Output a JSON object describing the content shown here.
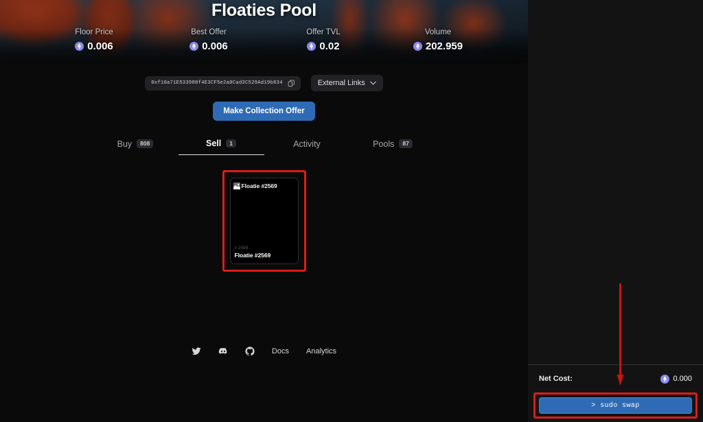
{
  "banner": {
    "title": "Floaties Pool",
    "background_alt": "blurred collection banner art",
    "stats": [
      {
        "label": "Floor Price",
        "value": "0.006",
        "currency_icon": "ethereum-icon"
      },
      {
        "label": "Best Offer",
        "value": "0.006",
        "currency_icon": "ethereum-icon"
      },
      {
        "label": "Offer TVL",
        "value": "0.02",
        "currency_icon": "ethereum-icon"
      },
      {
        "label": "Volume",
        "value": "202.959",
        "currency_icon": "ethereum-icon"
      }
    ]
  },
  "address_row": {
    "contract_address": "0xf10a71E533988f4E3CF5e2a0Cad3C529Ad19b834",
    "copy_icon": "copy-icon",
    "external_links_label": "External Links",
    "chevron_icon": "chevron-down-icon"
  },
  "cta": {
    "make_collection_offer": "Make Collection Offer"
  },
  "tabs": [
    {
      "label": "Buy",
      "badge": "808",
      "active": false
    },
    {
      "label": "Sell",
      "badge": "1",
      "active": true
    },
    {
      "label": "Activity",
      "badge": "",
      "active": false
    },
    {
      "label": "Pools",
      "badge": "87",
      "active": false
    }
  ],
  "nft_card": {
    "image_alt": "Floatie #2569",
    "broken_image_icon": "broken-image-icon",
    "token_id": "# 2569",
    "name": "Floatie #2569",
    "highlighted": true
  },
  "footer": {
    "icons": [
      {
        "name": "twitter-icon",
        "label": "Twitter"
      },
      {
        "name": "discord-icon",
        "label": "Discord"
      },
      {
        "name": "github-icon",
        "label": "GitHub"
      }
    ],
    "links": [
      "Docs",
      "Analytics"
    ]
  },
  "right_panel": {
    "net_cost_label": "Net Cost:",
    "net_cost_value": "0.000",
    "net_cost_icon": "ethereum-icon",
    "swap_button_label": "> sudo swap"
  },
  "annotations": {
    "arrow_color": "#e01b1b",
    "highlight_color": "#e01b1b"
  },
  "colors": {
    "accent_blue": "#2f6bb5",
    "background": "#0a0a0a",
    "panel": "#131313",
    "eth_purple": "#8a8ae8"
  }
}
